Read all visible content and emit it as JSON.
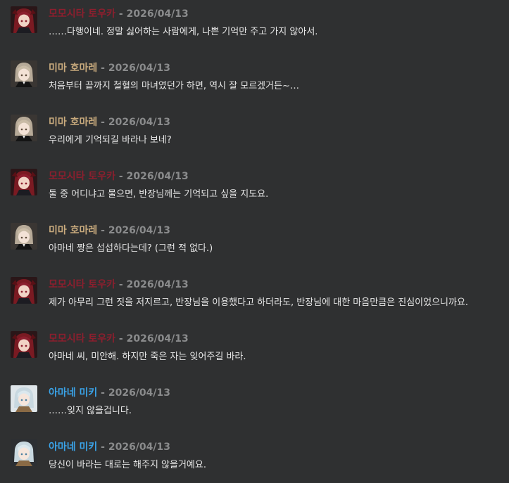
{
  "separator": "-",
  "colors": {
    "background": "#2f3031",
    "toka": "#8c1f2e",
    "homare": "#c8aa7d",
    "miki": "#3aa3e8",
    "date": "#8a8b8c",
    "text": "#e6e6e6"
  },
  "messages": [
    {
      "author": "모모시타 토우카",
      "author_color": "#8c1f2e",
      "avatar": "toka-avatar",
      "date": "2026/04/13",
      "text": "……다행이네. 정말 싫어하는 사람에게, 나쁜 기억만 주고 가지 않아서."
    },
    {
      "author": "미마 호마레",
      "author_color": "#c8aa7d",
      "avatar": "homare-avatar",
      "date": "2026/04/13",
      "text": "처음부터 끝까지 철혈의 마녀였던가 하면, 역시 잘 모르겠거든~…"
    },
    {
      "author": "미마 호마레",
      "author_color": "#c8aa7d",
      "avatar": "homare-avatar",
      "date": "2026/04/13",
      "text": "우리에게 기억되길 바라나 보네?"
    },
    {
      "author": "모모시타 토우카",
      "author_color": "#8c1f2e",
      "avatar": "toka-avatar",
      "date": "2026/04/13",
      "text": "둘 중 어디냐고 물으면, 반장님께는 기억되고 싶을 지도요."
    },
    {
      "author": "미마 호마레",
      "author_color": "#c8aa7d",
      "avatar": "homare-avatar",
      "date": "2026/04/13",
      "text": "아마네 짱은 섭섭하다는데? (그런 적 없다.)"
    },
    {
      "author": "모모시타 토우카",
      "author_color": "#8c1f2e",
      "avatar": "toka-avatar",
      "date": "2026/04/13",
      "text": "제가 아무리 그런 짓을 저지르고, 반장님을 이용했다고 하더라도, 반장님에 대한 마음만큼은 진심이었으니까요."
    },
    {
      "author": "모모시타 토우카",
      "author_color": "#8c1f2e",
      "avatar": "toka-avatar",
      "date": "2026/04/13",
      "text": "아마네 씨, 미안해. 하지만 죽은 자는 잊어주길 바라."
    },
    {
      "author": "아마네 미키",
      "author_color": "#3aa3e8",
      "avatar": "miki-avatar",
      "date": "2026/04/13",
      "text": "……잊지 않을겁니다."
    },
    {
      "author": "아마네 미키",
      "author_color": "#3aa3e8",
      "avatar": "miki-avatar",
      "date": "2026/04/13",
      "text": "당신이 바라는 대로는 해주지 않을거예요."
    }
  ]
}
